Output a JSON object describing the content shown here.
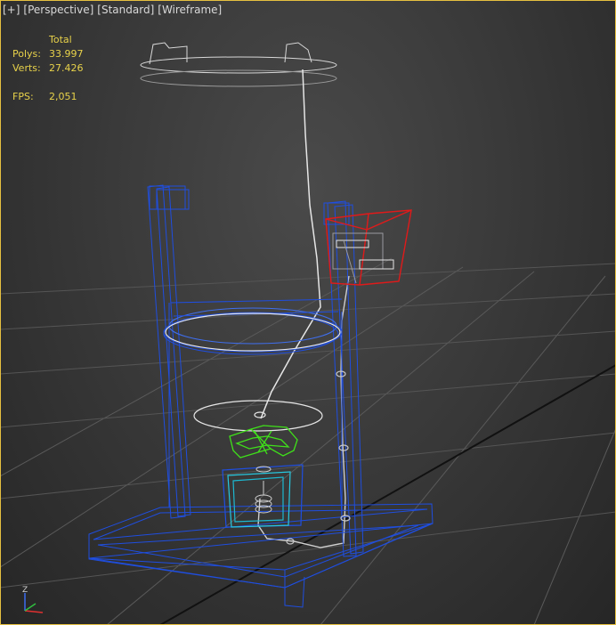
{
  "viewport": {
    "labels": [
      "[+]",
      "[Perspective]",
      "[Standard]",
      "[Wireframe]"
    ],
    "stats": {
      "header": "Total",
      "polys_label": "Polys:",
      "polys_value": "33.997",
      "verts_label": "Verts:",
      "verts_value": "27.426",
      "fps_label": "FPS:",
      "fps_value": "2,051"
    },
    "axis_label": "Z"
  },
  "colors": {
    "frame": "#1f4ee0",
    "wire_white": "#e8e8e8",
    "selected_red": "#e01a1a",
    "green_part": "#3fe01a",
    "cyan_part": "#27c8e0",
    "stats_text": "#e8d24a",
    "active_border": "#e6c040"
  }
}
